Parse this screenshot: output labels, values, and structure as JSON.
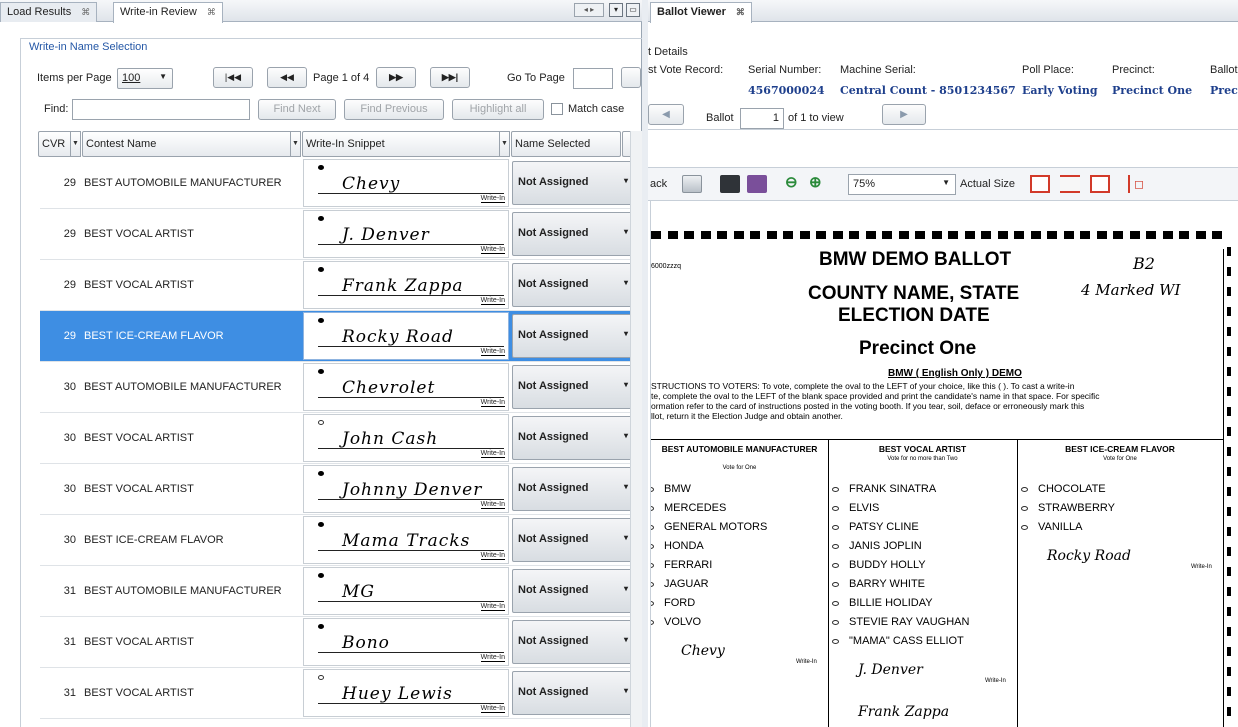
{
  "left_tabs": [
    {
      "label": "Load Results"
    },
    {
      "label": "Write-in Review"
    }
  ],
  "tab_close": "⌘",
  "right_tab": {
    "label": "Ballot Viewer"
  },
  "review": {
    "group_title": "Write-in Name Selection",
    "items_per_page_label": "Items per Page",
    "items_per_page_value": "100",
    "page_status": "Page 1 of 4",
    "go_to_page_label": "Go To Page",
    "find_label": "Find:",
    "find_next": "Find Next",
    "find_previous": "Find Previous",
    "highlight_all": "Highlight all",
    "match_case": "Match case",
    "columns": {
      "cvr": "CVR",
      "contest": "Contest Name",
      "snippet": "Write-In Snippet",
      "name_selected": "Name Selected"
    },
    "write_in_tag": "Write-In",
    "rows": [
      {
        "cvr": "29",
        "contest": "BEST AUTOMOBILE MANUFACTURER",
        "snippet": "Chevy",
        "name": "Not Assigned",
        "selected": false,
        "filled": true
      },
      {
        "cvr": "29",
        "contest": "BEST VOCAL ARTIST",
        "snippet": "J. Denver",
        "name": "Not Assigned",
        "selected": false,
        "filled": true
      },
      {
        "cvr": "29",
        "contest": "BEST VOCAL ARTIST",
        "snippet": "Frank Zappa",
        "name": "Not Assigned",
        "selected": false,
        "filled": true
      },
      {
        "cvr": "29",
        "contest": "BEST ICE-CREAM FLAVOR",
        "snippet": "Rocky Road",
        "name": "Not Assigned",
        "selected": true,
        "filled": true
      },
      {
        "cvr": "30",
        "contest": "BEST AUTOMOBILE MANUFACTURER",
        "snippet": "Chevrolet",
        "name": "Not Assigned",
        "selected": false,
        "filled": true
      },
      {
        "cvr": "30",
        "contest": "BEST VOCAL ARTIST",
        "snippet": "John Cash",
        "name": "Not Assigned",
        "selected": false,
        "filled": false
      },
      {
        "cvr": "30",
        "contest": "BEST VOCAL ARTIST",
        "snippet": "Johnny Denver",
        "name": "Not Assigned",
        "selected": false,
        "filled": true
      },
      {
        "cvr": "30",
        "contest": "BEST ICE-CREAM FLAVOR",
        "snippet": "Mama Tracks",
        "name": "Not Assigned",
        "selected": false,
        "filled": true
      },
      {
        "cvr": "31",
        "contest": "BEST AUTOMOBILE MANUFACTURER",
        "snippet": "MG",
        "name": "Not Assigned",
        "selected": false,
        "filled": true
      },
      {
        "cvr": "31",
        "contest": "BEST VOCAL ARTIST",
        "snippet": "Bono",
        "name": "Not Assigned",
        "selected": false,
        "filled": true
      },
      {
        "cvr": "31",
        "contest": "BEST VOCAL ARTIST",
        "snippet": "Huey Lewis",
        "name": "Not Assigned",
        "selected": false,
        "filled": false
      }
    ]
  },
  "viewer": {
    "details_label": "t Details",
    "fields": {
      "cast_vote_record": "st Vote Record:",
      "serial_label": "Serial Number:",
      "serial_value": "4567000024",
      "machine_label": "Machine Serial:",
      "machine_value": "Central Count - 8501234567",
      "poll_label": "Poll Place:",
      "poll_value": "Early Voting",
      "precinct_label": "Precinct:",
      "precinct_value": "Precinct One",
      "ballot_style_label": "Ballot S",
      "ballot_style_value": "Preci"
    },
    "ballot_label": "Ballot",
    "ballot_index": "1",
    "ballot_of": "of 1 to view",
    "back_label": "ack",
    "zoom_value": "75%",
    "actual_size": "Actual Size"
  },
  "ballot": {
    "code": "6000zzzq",
    "title": "BMW DEMO BALLOT",
    "county": "COUNTY NAME, STATE",
    "election": "ELECTION DATE",
    "precinct": "Precinct One",
    "subtitle": "BMW ( English Only ) DEMO",
    "hand_note_1": "B2",
    "hand_note_2": "4 Marked WI",
    "instructions": [
      "STRUCTIONS TO VOTERS: To vote, complete the oval to the LEFT of your choice, like this ( ). To cast a write-in",
      "te, complete the oval to the LEFT of the blank space provided and print the candidate's name in that space. For specific",
      "ormation refer to the card of instructions posted in the voting booth. If you tear, soil, deface or erroneously mark this",
      "llot, return it the Election Judge and obtain another."
    ],
    "contests": [
      {
        "title": "BEST AUTOMOBILE MANUFACTURER",
        "vote_for": "Vote for One",
        "options": [
          "BMW",
          "MERCEDES",
          "GENERAL MOTORS",
          "HONDA",
          "FERRARI",
          "JAGUAR",
          "FORD",
          "VOLVO"
        ],
        "writein": "Chevy"
      },
      {
        "title": "BEST VOCAL ARTIST",
        "vote_for": "Vote for no more than Two",
        "options": [
          "FRANK SINATRA",
          "ELVIS",
          "PATSY CLINE",
          "JANIS JOPLIN",
          "BUDDY HOLLY",
          "BARRY WHITE",
          "BILLIE HOLIDAY",
          "STEVIE RAY VAUGHAN",
          "\"MAMA\" CASS ELLIOT"
        ],
        "writein": "J. Denver",
        "writein2": "Frank Zappa"
      },
      {
        "title": "BEST ICE-CREAM FLAVOR",
        "vote_for": "Vote for One",
        "options": [
          "CHOCOLATE",
          "STRAWBERRY",
          "VANILLA"
        ],
        "writein": "Rocky Road"
      }
    ],
    "write_in_tag": "Write-In"
  }
}
